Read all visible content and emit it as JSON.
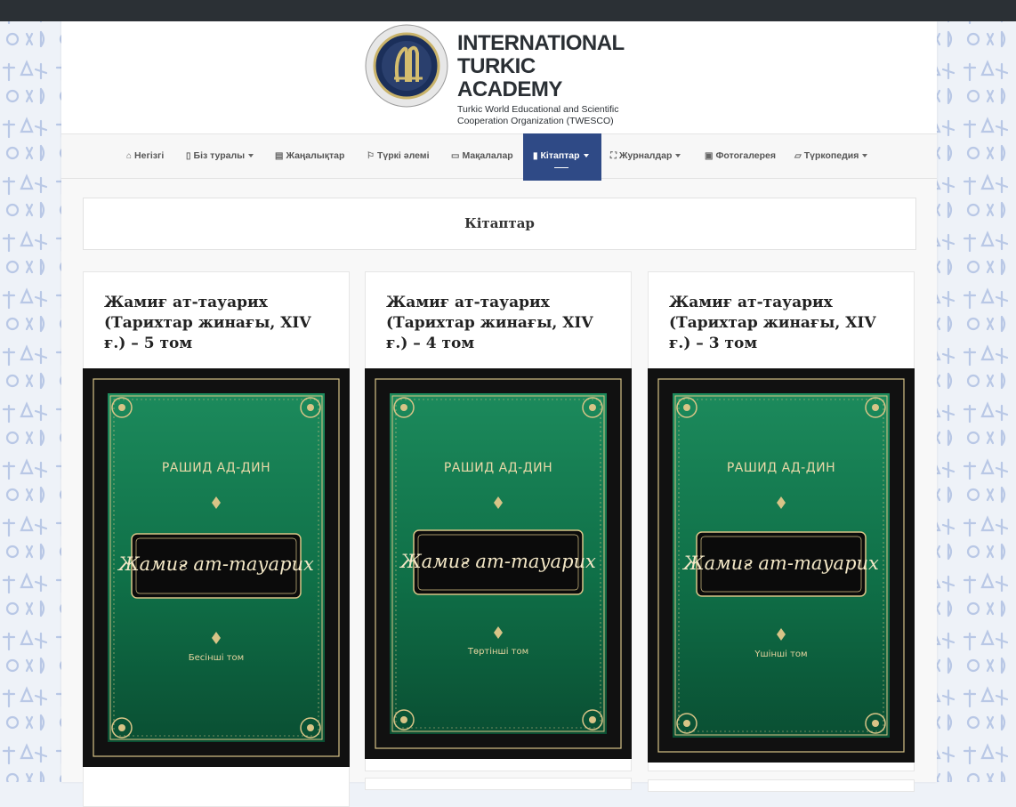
{
  "logo": {
    "line1": "INTERNATIONAL",
    "line2": "TURKIC ACADEMY",
    "line3": "Turkic World Educational and Scientific",
    "line4": "Cooperation Organization (TWESCO)",
    "seal_text": "INTERNATIONAL TURKIC ACADEMY"
  },
  "nav": {
    "items": [
      {
        "label": "Негізгі",
        "icon": "home-icon",
        "dropdown": false
      },
      {
        "label": "Біз туралы",
        "icon": "bookmark-icon",
        "dropdown": true
      },
      {
        "label": "Жаңалықтар",
        "icon": "newspaper-icon",
        "dropdown": false
      },
      {
        "label": "Түркі әлемі",
        "icon": "flag-icon",
        "dropdown": false
      },
      {
        "label": "Мақалалар",
        "icon": "file-text-icon",
        "dropdown": false
      },
      {
        "label": "Кітаптар",
        "icon": "book-icon",
        "dropdown": true,
        "active": true
      },
      {
        "label": "Журналдар",
        "icon": "language-icon",
        "dropdown": true
      },
      {
        "label": "Фотогалерея",
        "icon": "file-image-icon",
        "dropdown": false
      },
      {
        "label": "Түркопедия",
        "icon": "folder-open-icon",
        "dropdown": true
      }
    ]
  },
  "page": {
    "title": "Кітаптар"
  },
  "books": [
    {
      "title": "Жамиғ ат-тауарих (Тарихтар жинағы, XIV ғ.) – 5 том",
      "cover_author": "РАШИД АД-ДИН",
      "cover_title": "Жамиғ ат-тауарих",
      "cover_volume": "Бесінші том"
    },
    {
      "title": "Жамиғ ат-тауарих (Тарихтар жинағы, XIV ғ.) – 4 том",
      "cover_author": "РАШИД АД-ДИН",
      "cover_title": "Жамиғ ат-тауарих",
      "cover_volume": "Төртінші том"
    },
    {
      "title": "Жамиғ ат-тауарих (Тарихтар жинағы, XIV ғ.) – 3 том",
      "cover_author": "РАШИД АД-ДИН",
      "cover_title": "Жамиғ ат-тауарих",
      "cover_volume": "Үшінші том"
    }
  ],
  "colors": {
    "topbar": "#2b3035",
    "nav_active": "#2f4a86",
    "cover_green": "#0f6f47",
    "cover_frame": "#111111",
    "gold": "#d8c487"
  }
}
